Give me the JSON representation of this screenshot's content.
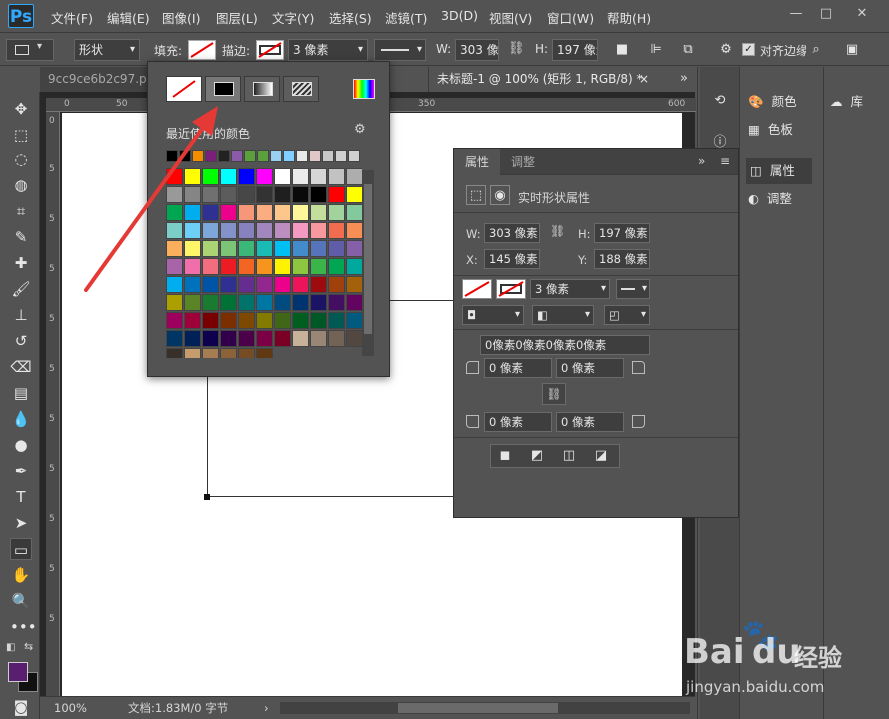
{
  "app": {
    "logo": "Ps"
  },
  "menu": [
    "文件(F)",
    "编辑(E)",
    "图像(I)",
    "图层(L)",
    "文字(Y)",
    "选择(S)",
    "滤镜(T)",
    "3D(D)",
    "视图(V)",
    "窗口(W)",
    "帮助(H)"
  ],
  "window_controls": {
    "minimize": "—",
    "maximize": "□",
    "close": "✕"
  },
  "options": {
    "mode": "形状",
    "fill_label": "填充:",
    "stroke_label": "描边:",
    "stroke_width": "3 像素",
    "w_label": "W:",
    "w_value": "303 像素",
    "h_label": "H:",
    "h_value": "197 像素",
    "align_edges": "对齐边缘"
  },
  "tabs": [
    {
      "label": "9cc9ce6b2c97.psd"
    },
    {
      "label": "未标题-1 @ 100% (矩形 1, RGB/8) *",
      "close": "×"
    }
  ],
  "tab_overflow": "»",
  "ruler": {
    "top_ticks": [
      "0",
      "50",
      "100",
      "350",
      "400",
      "450",
      "500",
      "550",
      "600"
    ],
    "left_ticks": [
      "0",
      "5",
      "5",
      "5",
      "5",
      "5",
      "5",
      "5",
      "5",
      "5",
      "5"
    ]
  },
  "status": {
    "zoom": "100%",
    "doc": "文档:1.83M/0 字节",
    "arrow": "›"
  },
  "color_popup": {
    "recent_label": "最近使用的颜色",
    "gear": "⚙"
  },
  "recent_colors": [
    "#000000",
    "#000000",
    "#f28d00",
    "#7a1f7a",
    "#222222",
    "#8b5aa8",
    "#5aa03c",
    "#5aa03c",
    "#9ad0f0",
    "#7fd0ff",
    "#e8e8e8",
    "#e0c8c8",
    "#c8c8c8",
    "#d0d0d0",
    "#d0d0d0"
  ],
  "swatches": [
    [
      "#ff0000",
      "#ffff00",
      "#00ff00",
      "#00ffff",
      "#0000ff",
      "#ff00ff",
      "#ffffff",
      "#ebebeb",
      "#d6d6d6",
      "#c2c2c2",
      "#adadad"
    ],
    [
      "#999999",
      "#858585",
      "#707070",
      "#5c5c5c",
      "#474747",
      "#333333",
      "#1f1f1f",
      "#0a0a0a",
      "#000000",
      "#ff0000",
      "#ffff00"
    ],
    [
      "#00a651",
      "#00aeef",
      "#2e3192",
      "#ec008c",
      "#f7977a",
      "#f9ad81",
      "#fdc68a",
      "#fff79a",
      "#c4df9b",
      "#a3d39c",
      "#82ca9d"
    ],
    [
      "#7bcdc8",
      "#6dcff6",
      "#7da7d9",
      "#8393ca",
      "#8781bd",
      "#a187be",
      "#bc8dbf",
      "#f49ac2",
      "#f6989d",
      "#f26c4f",
      "#f68e56"
    ],
    [
      "#fbaf5d",
      "#fff568",
      "#acd373",
      "#7cc576",
      "#3bb878",
      "#1abbb4",
      "#00bff3",
      "#438ccb",
      "#5574b9",
      "#605ca8",
      "#855fa8"
    ],
    [
      "#a864a8",
      "#f06ea9",
      "#f26d7d",
      "#ed1c24",
      "#f26522",
      "#f7941d",
      "#fff200",
      "#8dc63f",
      "#39b54a",
      "#00a651",
      "#00a99d"
    ],
    [
      "#00aeef",
      "#0072bc",
      "#0054a6",
      "#2e3192",
      "#662d91",
      "#92278f",
      "#ec008c",
      "#ed145b",
      "#9e0b0f",
      "#a0410d",
      "#a36209"
    ],
    [
      "#aba000",
      "#598527",
      "#197b30",
      "#007236",
      "#00746b",
      "#0076a3",
      "#004b80",
      "#003471",
      "#1b1464",
      "#440e62",
      "#630460"
    ],
    [
      "#9e005d",
      "#9e0039",
      "#790000",
      "#7b2e00",
      "#7d4900",
      "#827b00",
      "#406618",
      "#005e20",
      "#005826",
      "#005952",
      "#005b7f"
    ],
    [
      "#003663",
      "#002157",
      "#0d004c",
      "#32004b",
      "#4b0049",
      "#7b0046",
      "#7a0026",
      "#c7b299",
      "#998675",
      "#736357",
      "#534741"
    ],
    [
      "#37302a",
      "#c69c6d",
      "#a67c52",
      "#8c6239",
      "#754c24",
      "#603913"
    ]
  ],
  "properties": {
    "tab_active": "属性",
    "tab_other": "调整",
    "title": "实时形状属性",
    "w_label": "W:",
    "w_value": "303 像素",
    "h_label": "H:",
    "h_value": "197 像素",
    "x_label": "X:",
    "x_value": "145 像素",
    "y_label": "Y:",
    "y_value": "188 像素",
    "stroke_width": "3 像素",
    "corners_all": "0像素0像素0像素0像素",
    "corner_tl": "0 像素",
    "corner_tr": "0 像素",
    "corner_bl": "0 像素",
    "corner_br": "0 像素"
  },
  "right_dock": {
    "color": "颜色",
    "swatches": "色板",
    "library": "库",
    "properties": "属性",
    "adjustments": "调整"
  },
  "watermark": {
    "brand": "Bai",
    "brand2": "du",
    "suffix": "经验",
    "url": "jingyan.baidu.com"
  }
}
